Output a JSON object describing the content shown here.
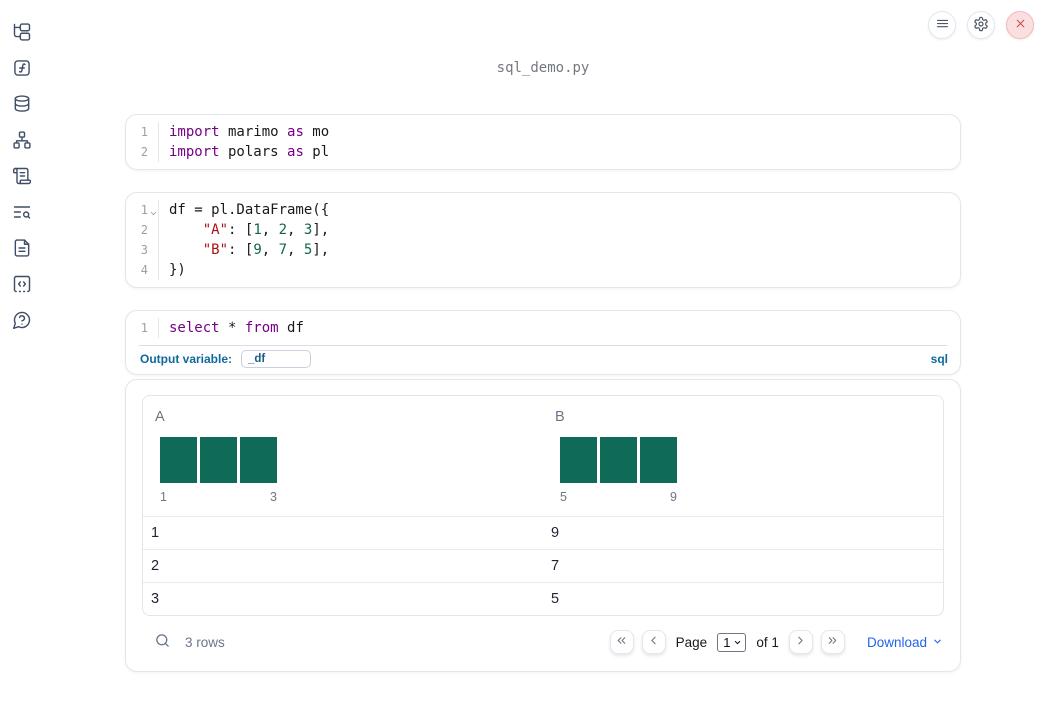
{
  "title": "sql_demo.py",
  "toolbar": {
    "buttons": [
      {
        "icon": "menu-icon"
      },
      {
        "icon": "gear-icon"
      },
      {
        "icon": "close-icon"
      }
    ]
  },
  "sidebar": {
    "items": [
      {
        "icon": "file-tree-icon"
      },
      {
        "icon": "function-square-icon"
      },
      {
        "icon": "database-icon"
      },
      {
        "icon": "dependency-graph-icon"
      },
      {
        "icon": "scroll-text-icon"
      },
      {
        "icon": "text-search-icon"
      },
      {
        "icon": "document-icon"
      },
      {
        "icon": "code-snippet-icon"
      },
      {
        "icon": "help-bubble-icon"
      }
    ]
  },
  "cells": [
    {
      "lines": [
        {
          "n": "1",
          "tokens": [
            [
              "kw",
              "import"
            ],
            [
              "plain",
              " marimo "
            ],
            [
              "kw",
              "as"
            ],
            [
              "plain",
              " mo"
            ]
          ]
        },
        {
          "n": "2",
          "tokens": [
            [
              "kw",
              "import"
            ],
            [
              "plain",
              " polars "
            ],
            [
              "kw",
              "as"
            ],
            [
              "plain",
              " pl"
            ]
          ]
        }
      ]
    },
    {
      "lines": [
        {
          "n": "1",
          "fold": true,
          "tokens": [
            [
              "plain",
              "df = pl.DataFrame({"
            ]
          ]
        },
        {
          "n": "2",
          "tokens": [
            [
              "plain",
              "    "
            ],
            [
              "str",
              "\"A\""
            ],
            [
              "plain",
              ": ["
            ],
            [
              "num",
              "1"
            ],
            [
              "plain",
              ", "
            ],
            [
              "num",
              "2"
            ],
            [
              "plain",
              ", "
            ],
            [
              "num",
              "3"
            ],
            [
              "plain",
              "],"
            ]
          ]
        },
        {
          "n": "3",
          "tokens": [
            [
              "plain",
              "    "
            ],
            [
              "str",
              "\"B\""
            ],
            [
              "plain",
              ": ["
            ],
            [
              "num",
              "9"
            ],
            [
              "plain",
              ", "
            ],
            [
              "num",
              "7"
            ],
            [
              "plain",
              ", "
            ],
            [
              "num",
              "5"
            ],
            [
              "plain",
              "],"
            ]
          ]
        },
        {
          "n": "4",
          "tokens": [
            [
              "plain",
              "})"
            ]
          ]
        }
      ]
    },
    {
      "lines": [
        {
          "n": "1",
          "tokens": [
            [
              "kw",
              "select"
            ],
            [
              "plain",
              " * "
            ],
            [
              "kw",
              "from"
            ],
            [
              "plain",
              " df"
            ]
          ]
        }
      ],
      "footer": {
        "label": "Output variable:",
        "value": "_df",
        "language": "sql"
      }
    }
  ],
  "table": {
    "columns": [
      {
        "header": "A",
        "histogram": {
          "counts": [
            1,
            1,
            1
          ],
          "min_label": "1",
          "max_label": "3"
        }
      },
      {
        "header": "B",
        "histogram": {
          "counts": [
            1,
            1,
            1
          ],
          "min_label": "5",
          "max_label": "9"
        }
      }
    ],
    "rows": [
      [
        "1",
        "9"
      ],
      [
        "2",
        "7"
      ],
      [
        "3",
        "5"
      ]
    ],
    "footer": {
      "row_count": "3 rows",
      "page_label": "Page",
      "page_value": "1",
      "page_total_label": "of 1",
      "download_label": "Download"
    }
  },
  "colors": {
    "keyword": "#770088",
    "string": "#aa1111",
    "number": "#116644",
    "histogram_bar": "#0f6a58",
    "accent_blue": "#0e6a9b",
    "link_blue": "#2563eb",
    "danger_red": "#cf4b4f"
  }
}
